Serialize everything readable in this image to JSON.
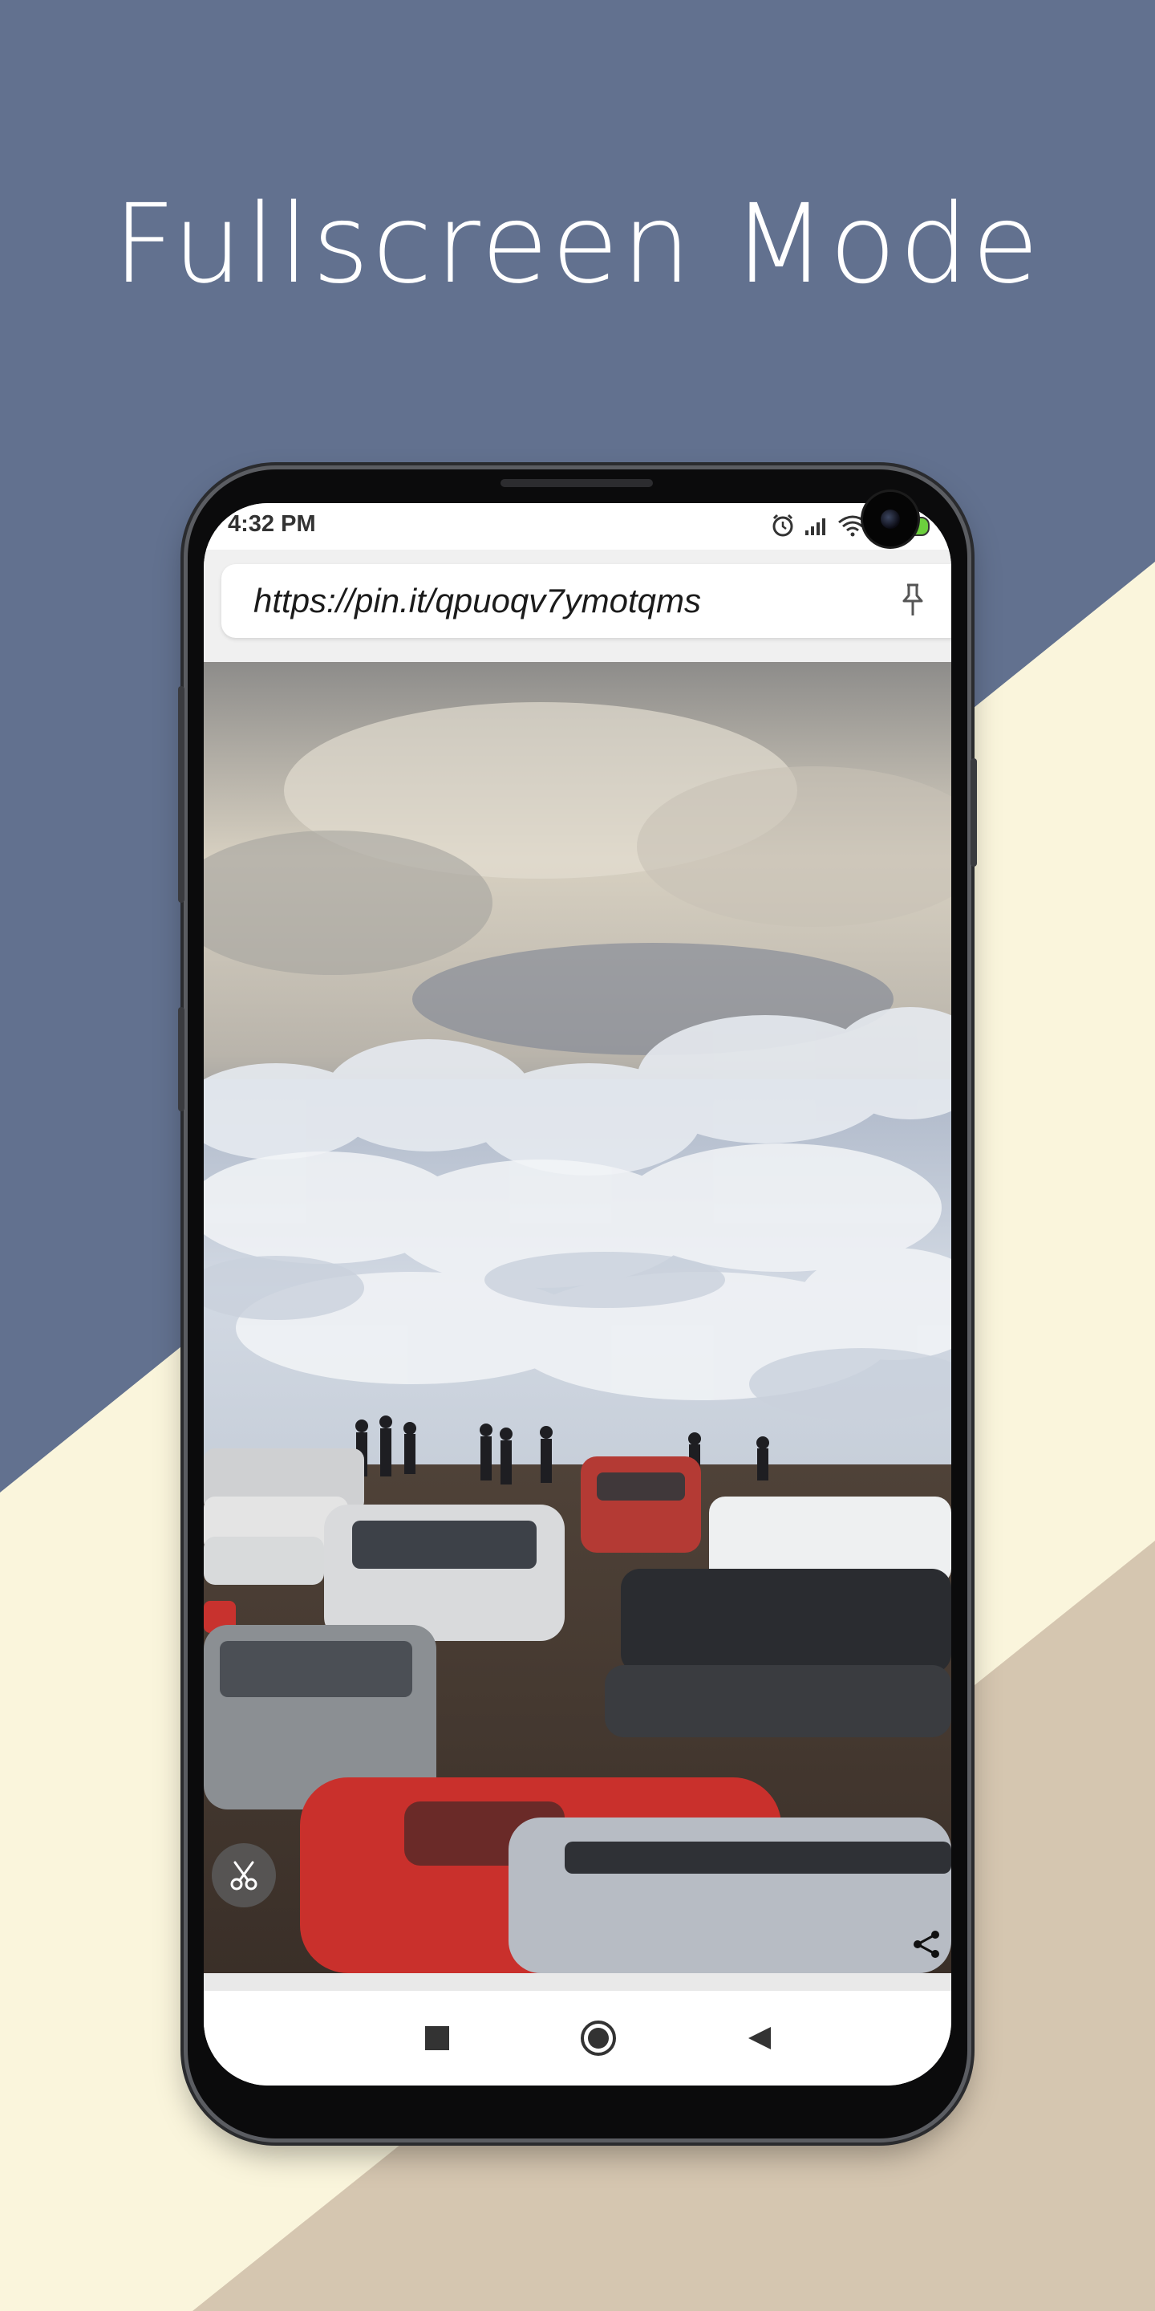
{
  "headline": "Fullscreen Mode",
  "status_bar": {
    "time": "4:32 PM",
    "battery": "100",
    "icons": [
      "alarm-icon",
      "signal-icon",
      "wifi-icon",
      "battery-icon"
    ]
  },
  "url_bar": {
    "url": "https://pin.it/qpuoqv7ymotqms",
    "pin_icon": "pin-icon"
  },
  "video": {
    "cut_icon": "scissors-icon",
    "share_icon": "share-icon"
  },
  "nav_bar": {
    "buttons": [
      "recents-square-icon",
      "home-circle-icon",
      "back-triangle-icon"
    ]
  },
  "colors": {
    "background_blue": "#62718f",
    "background_cream": "#faf5dc",
    "background_tan": "#d5c6b0",
    "battery_green": "#6ccf3d"
  }
}
